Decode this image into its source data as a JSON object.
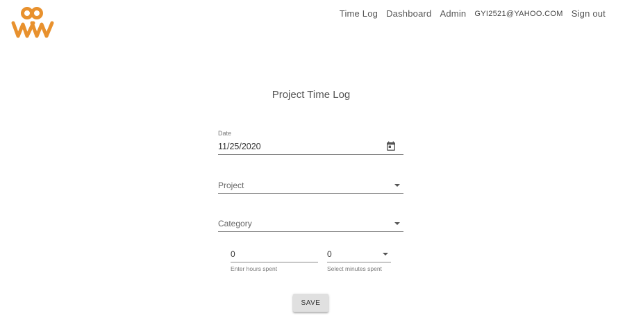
{
  "header": {
    "logo_icon": "ww-logo-icon",
    "brand_color": "#E8912E",
    "nav": {
      "time_log": "Time Log",
      "dashboard": "Dashboard",
      "admin": "Admin",
      "user_email": "GYI2521@YAHOO.COM",
      "sign_out": "Sign out"
    }
  },
  "form": {
    "title": "Project Time Log",
    "date": {
      "label": "Date",
      "value": "11/25/2020",
      "icon": "calendar-icon"
    },
    "project": {
      "placeholder": "Project",
      "icon": "dropdown-arrow-icon"
    },
    "category": {
      "placeholder": "Category",
      "icon": "dropdown-arrow-icon"
    },
    "hours": {
      "value": "0",
      "helper": "Enter hours spent"
    },
    "minutes": {
      "value": "0",
      "helper": "Select minutes spent",
      "icon": "dropdown-arrow-icon"
    },
    "save_label": "SAVE"
  }
}
